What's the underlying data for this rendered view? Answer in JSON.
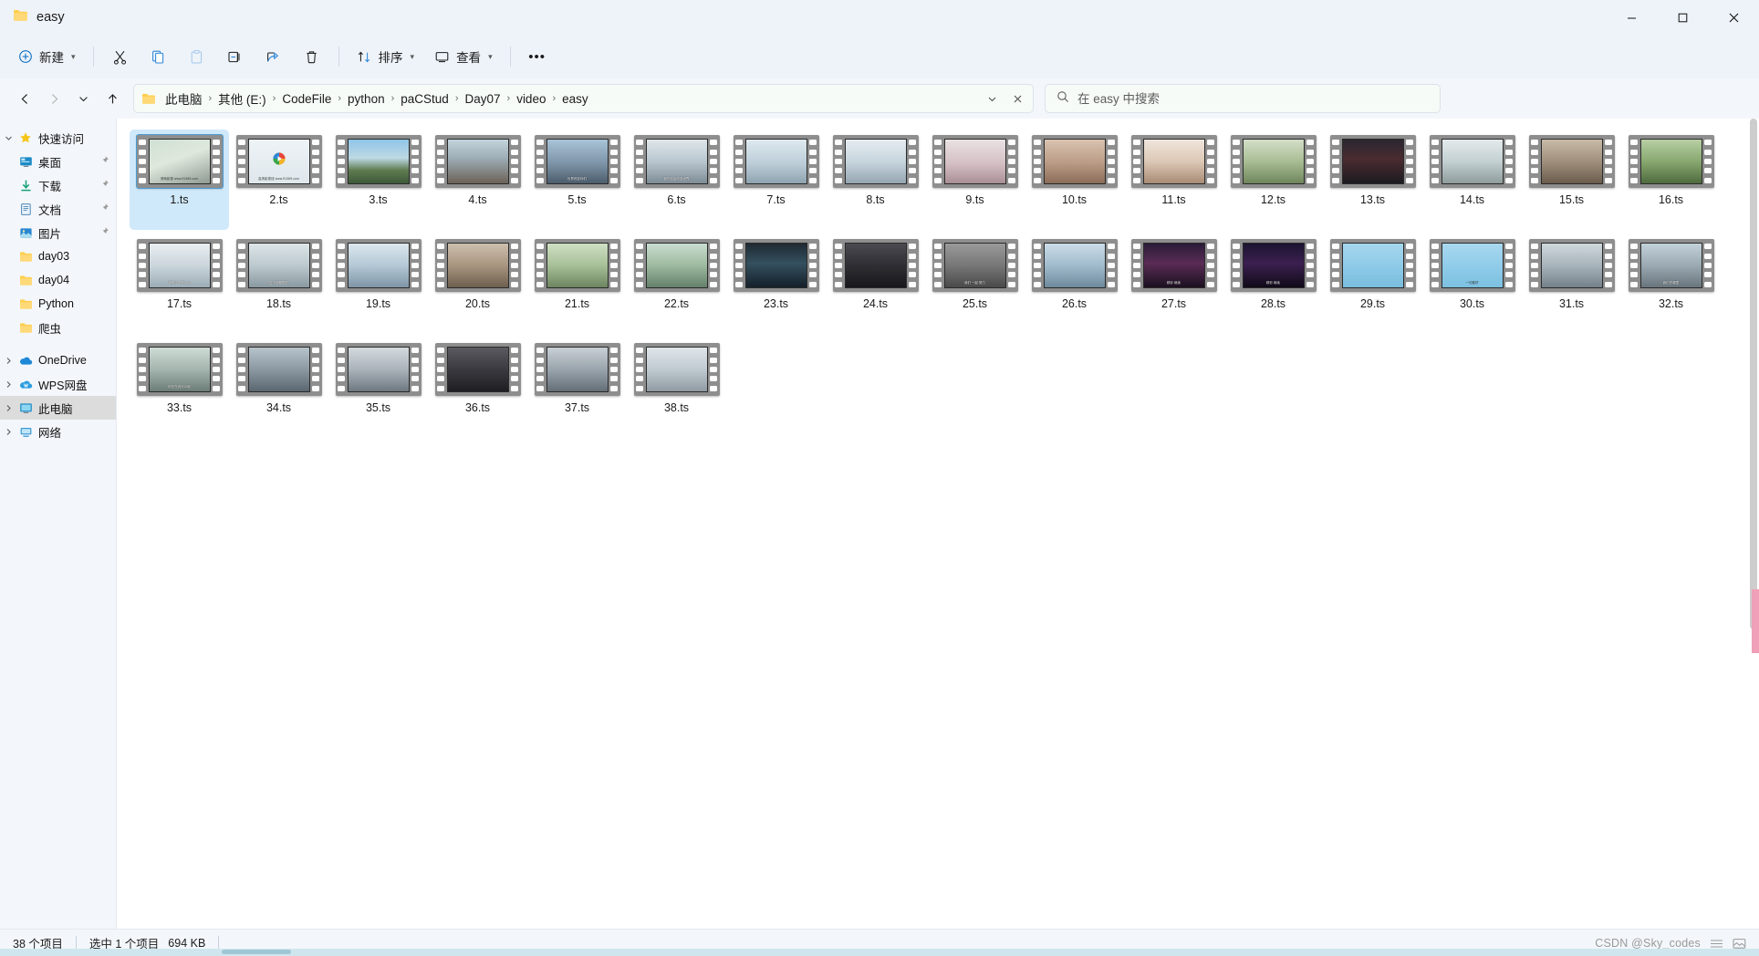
{
  "window": {
    "title": "easy",
    "folder_icon": "folder-icon",
    "controls": {
      "minimize": "–",
      "maximize": "❐",
      "close": "✕"
    }
  },
  "toolbar": {
    "new_label": "新建",
    "sort_label": "排序",
    "view_label": "查看",
    "more_label": "•••",
    "icons": [
      "cut-icon",
      "copy-icon",
      "paste-icon",
      "rename-icon",
      "share-icon",
      "delete-icon"
    ]
  },
  "address": {
    "back": "←",
    "forward": "→",
    "recent": "⌄",
    "up": "↑",
    "crumbs": [
      "此电脑",
      "其他 (E:)",
      "CodeFile",
      "python",
      "paCStud",
      "Day07",
      "video",
      "easy"
    ],
    "separator": "›",
    "dropdown": "⌄",
    "refresh": "✕"
  },
  "search": {
    "icon": "search-icon",
    "placeholder": "在 easy 中搜索",
    "value": ""
  },
  "sidebar": {
    "quick_access": {
      "label": "快速访问",
      "icon": "star-icon",
      "expanded": true
    },
    "pinned": [
      {
        "label": "桌面",
        "icon": "desktop-icon",
        "pinned": true
      },
      {
        "label": "下载",
        "icon": "downloads-icon",
        "pinned": true
      },
      {
        "label": "文档",
        "icon": "documents-icon",
        "pinned": true
      },
      {
        "label": "图片",
        "icon": "pictures-icon",
        "pinned": true
      },
      {
        "label": "day03",
        "icon": "folder-icon",
        "pinned": false
      },
      {
        "label": "day04",
        "icon": "folder-icon",
        "pinned": false
      },
      {
        "label": "Python",
        "icon": "folder-icon",
        "pinned": false
      },
      {
        "label": "爬虫",
        "icon": "folder-icon",
        "pinned": false
      }
    ],
    "roots": [
      {
        "label": "OneDrive",
        "icon": "onedrive-icon",
        "selected": false
      },
      {
        "label": "WPS网盘",
        "icon": "wps-cloud-icon",
        "selected": false
      },
      {
        "label": "此电脑",
        "icon": "this-pc-icon",
        "selected": true
      },
      {
        "label": "网络",
        "icon": "network-icon",
        "selected": false
      }
    ]
  },
  "files": [
    {
      "name": "1.ts",
      "selected": true,
      "style": "pale-green",
      "caption": "清晰影视 www.91369.com",
      "play": false
    },
    {
      "name": "2.ts",
      "selected": false,
      "style": "white-logo",
      "caption": "高清影视线 www.91369.com",
      "play": true
    },
    {
      "name": "3.ts",
      "selected": false,
      "style": "landscape",
      "caption": "",
      "play": false
    },
    {
      "name": "4.ts",
      "selected": false,
      "style": "street",
      "caption": "",
      "play": false
    },
    {
      "name": "5.ts",
      "selected": false,
      "style": "crowd-blue",
      "caption": "世界改变你们",
      "play": false
    },
    {
      "name": "6.ts",
      "selected": false,
      "style": "indoor-group",
      "caption": "我们也会改变世界",
      "play": false
    },
    {
      "name": "7.ts",
      "selected": false,
      "style": "two-people",
      "caption": "",
      "play": false
    },
    {
      "name": "8.ts",
      "selected": false,
      "style": "two-people-2",
      "caption": "",
      "play": false
    },
    {
      "name": "9.ts",
      "selected": false,
      "style": "woman-pink",
      "caption": "",
      "play": false
    },
    {
      "name": "10.ts",
      "selected": false,
      "style": "couple-warm",
      "caption": "",
      "play": false
    },
    {
      "name": "11.ts",
      "selected": false,
      "style": "woman-smile",
      "caption": "",
      "play": false
    },
    {
      "name": "12.ts",
      "selected": false,
      "style": "man-green",
      "caption": "",
      "play": false
    },
    {
      "name": "13.ts",
      "selected": false,
      "style": "night-red",
      "caption": "",
      "play": false
    },
    {
      "name": "14.ts",
      "selected": false,
      "style": "man-outdoor",
      "caption": "",
      "play": false
    },
    {
      "name": "15.ts",
      "selected": false,
      "style": "street-crowd",
      "caption": "",
      "play": false
    },
    {
      "name": "16.ts",
      "selected": false,
      "style": "field-green",
      "caption": "",
      "play": false
    },
    {
      "name": "17.ts",
      "selected": false,
      "style": "group-white",
      "caption": "我们应该怎么办",
      "play": false
    },
    {
      "name": "18.ts",
      "selected": false,
      "style": "table-group",
      "caption": "这个问题很好",
      "play": false
    },
    {
      "name": "19.ts",
      "selected": false,
      "style": "two-blue",
      "caption": "",
      "play": false
    },
    {
      "name": "20.ts",
      "selected": false,
      "style": "corridor",
      "caption": "",
      "play": false
    },
    {
      "name": "21.ts",
      "selected": false,
      "style": "garden",
      "caption": "",
      "play": false
    },
    {
      "name": "22.ts",
      "selected": false,
      "style": "couple-green",
      "caption": "",
      "play": false
    },
    {
      "name": "23.ts",
      "selected": false,
      "style": "night-walk",
      "caption": "",
      "play": false
    },
    {
      "name": "24.ts",
      "selected": false,
      "style": "man-dark",
      "caption": "",
      "play": false
    },
    {
      "name": "25.ts",
      "selected": false,
      "style": "gray-two",
      "caption": "我们 一起 努力",
      "play": false
    },
    {
      "name": "26.ts",
      "selected": false,
      "style": "blue-table",
      "caption": "",
      "play": false
    },
    {
      "name": "27.ts",
      "selected": false,
      "style": "night-lights",
      "caption": "精彩 继续",
      "play": false
    },
    {
      "name": "28.ts",
      "selected": false,
      "style": "tower-night",
      "caption": "精彩 继续",
      "play": false
    },
    {
      "name": "29.ts",
      "selected": false,
      "style": "sky-blue",
      "caption": "",
      "play": false
    },
    {
      "name": "30.ts",
      "selected": false,
      "style": "title-card",
      "caption": "一切都好",
      "play": false
    },
    {
      "name": "31.ts",
      "selected": false,
      "style": "city-road",
      "caption": "",
      "play": false
    },
    {
      "name": "32.ts",
      "selected": false,
      "style": "highway",
      "caption": "我们去哪里",
      "play": false
    },
    {
      "name": "33.ts",
      "selected": false,
      "style": "road-trees",
      "caption": "你们在说什么呢",
      "play": false
    },
    {
      "name": "34.ts",
      "selected": false,
      "style": "car-inside",
      "caption": "",
      "play": false
    },
    {
      "name": "35.ts",
      "selected": false,
      "style": "man-shirt",
      "caption": "",
      "play": false
    },
    {
      "name": "36.ts",
      "selected": false,
      "style": "man-dark-2",
      "caption": "",
      "play": false
    },
    {
      "name": "37.ts",
      "selected": false,
      "style": "man-car",
      "caption": "",
      "play": false
    },
    {
      "name": "38.ts",
      "selected": false,
      "style": "car-front",
      "caption": "",
      "play": false
    }
  ],
  "status": {
    "item_count": "38 个项目",
    "selection": "选中 1 个项目",
    "size": "694 KB",
    "watermark": "CSDN @Sky_codes",
    "view_icons": [
      "details-view-icon",
      "thumbnail-view-icon"
    ]
  },
  "colors": {
    "accent": "#0078d4",
    "selection": "#cfe8fa",
    "chrome": "#eef3f9",
    "content_bg": "#ffffff"
  }
}
